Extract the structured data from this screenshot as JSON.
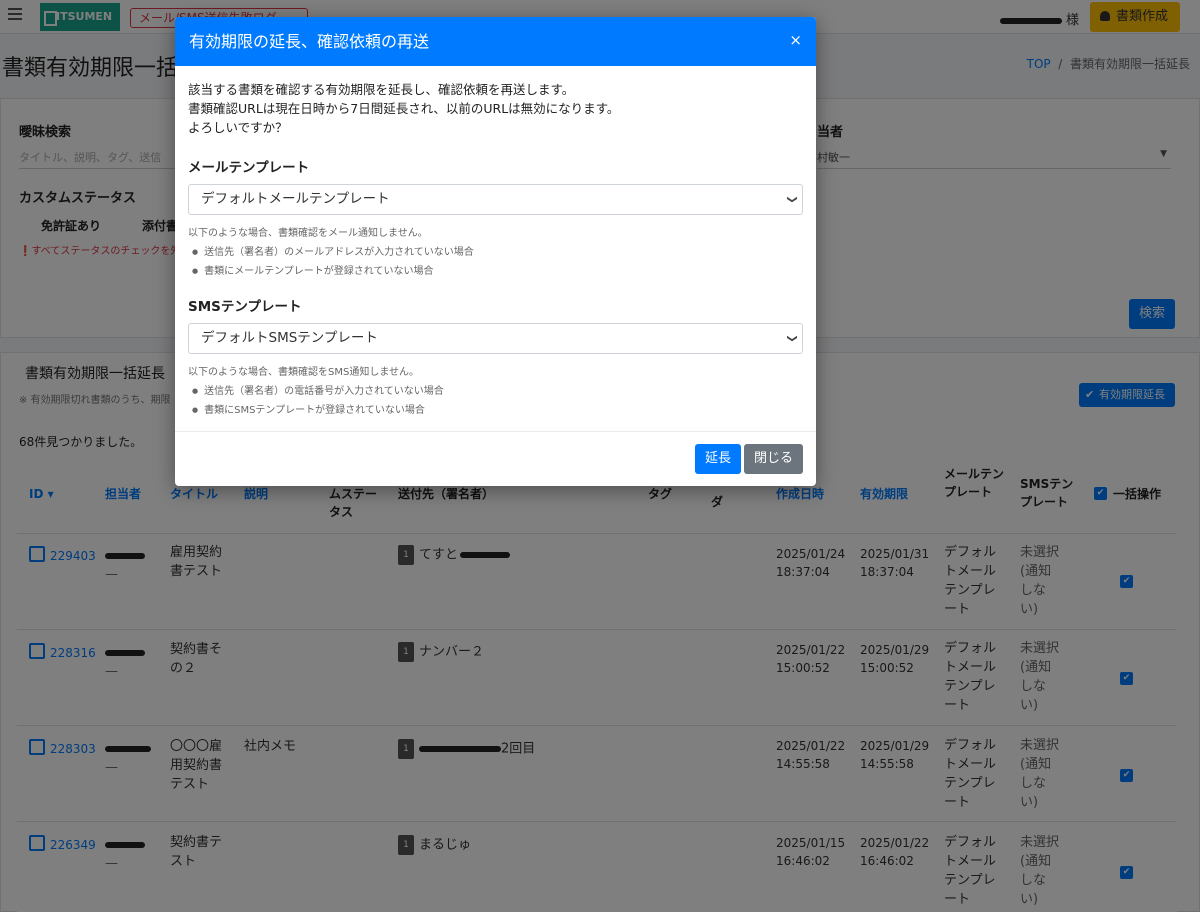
{
  "nav": {
    "logo": "ITSUMEN",
    "mail_log": "メール/SMS送信失敗ログ",
    "honorific": "様",
    "create_button": "書類作成"
  },
  "page": {
    "title": "書類有効期限一括延長",
    "breadcrumb_top": "TOP",
    "breadcrumb_sep": "/",
    "breadcrumb_current": "書類有効期限一括延長"
  },
  "search": {
    "fuzzy_label": "曖昧検索",
    "fuzzy_placeholder": "タイトル、説明、タグ、送信",
    "assignee_label": "当者",
    "assignee_value": "村敏一",
    "custom_status_label": "カスタムステータス",
    "status_1": "免許証あり",
    "status_2": "添付書",
    "warning": "すべてステータスのチェックを外",
    "search_button": "検索"
  },
  "list": {
    "title": "書類有効期限一括延長",
    "note": "※ 有効期限切れ書類のうち、期限",
    "bulk_extend_button": "有効期限延長",
    "found": "68件見つかりました。",
    "headers": {
      "id": "ID ▾",
      "assignee": "担当者",
      "title": "タイトル",
      "description": "説明",
      "custom_status": "ムステータス",
      "recipient": "送付先（署名者）",
      "tag": "タグ",
      "folder": "ダ",
      "created": "作成日時",
      "expiry": "有効期限",
      "mail_tpl": "メールテンプレート",
      "sms_tpl": "SMSテンプレート",
      "bulk": "一括操作"
    },
    "rows": [
      {
        "id": "229403",
        "assignee": "—",
        "title": "雇用契約書テスト",
        "description": "",
        "badge": "1",
        "recipient": "てすと",
        "created": "2025/01/24 18:37:04",
        "expiry": "2025/01/31 18:37:04",
        "mail_tpl": "デフォルトメールテンプレート",
        "sms_tpl": "未選択(通知しない)"
      },
      {
        "id": "228316",
        "assignee": "—",
        "title": "契約書その２",
        "description": "",
        "badge": "1",
        "recipient": "ナンバー２",
        "created": "2025/01/22 15:00:52",
        "expiry": "2025/01/29 15:00:52",
        "mail_tpl": "デフォルトメールテンプレート",
        "sms_tpl": "未選択(通知しない)"
      },
      {
        "id": "228303",
        "assignee": "—",
        "title": "〇〇〇雇用契約書テスト",
        "description": "社内メモ",
        "badge": "1",
        "recipient": "2回目",
        "created": "2025/01/22 14:55:58",
        "expiry": "2025/01/29 14:55:58",
        "mail_tpl": "デフォルトメールテンプレート",
        "sms_tpl": "未選択(通知しない)"
      },
      {
        "id": "226349",
        "assignee": "—",
        "title": "契約書テスト",
        "description": "",
        "badge": "1",
        "recipient": "まるじゅ",
        "created": "2025/01/15 16:46:02",
        "expiry": "2025/01/22 16:46:02",
        "mail_tpl": "デフォルトメールテンプレート",
        "sms_tpl": "未選択(通知しない)"
      }
    ]
  },
  "modal": {
    "title": "有効期限の延長、確認依頼の再送",
    "close_glyph": "×",
    "intro_1": "該当する書類を確認する有効期限を延長し、確認依頼を再送します。",
    "intro_2": "書類確認URLは現在日時から7日間延長され、以前のURLは無効になります。",
    "intro_3": "よろしいですか？",
    "mail_section": "メールテンプレート",
    "mail_select": "デフォルトメールテンプレート",
    "mail_help": "以下のような場合、書類確認をメール通知しません。",
    "mail_help_1": "送信先（署名者）のメールアドレスが入力されていない場合",
    "mail_help_2": "書類にメールテンプレートが登録されていない場合",
    "sms_section": "SMSテンプレート",
    "sms_select": "デフォルトSMSテンプレート",
    "sms_help": "以下のような場合、書類確認をSMS通知しません。",
    "sms_help_1": "送信先（署名者）の電話番号が入力されていない場合",
    "sms_help_2": "書類にSMSテンプレートが登録されていない場合",
    "extend_button": "延長",
    "close_button": "閉じる"
  },
  "colors": {
    "primary": "#007bff",
    "brand": "#1ba58c",
    "warning": "#ffc107",
    "danger": "#dc3545",
    "secondary": "#6c757d"
  }
}
